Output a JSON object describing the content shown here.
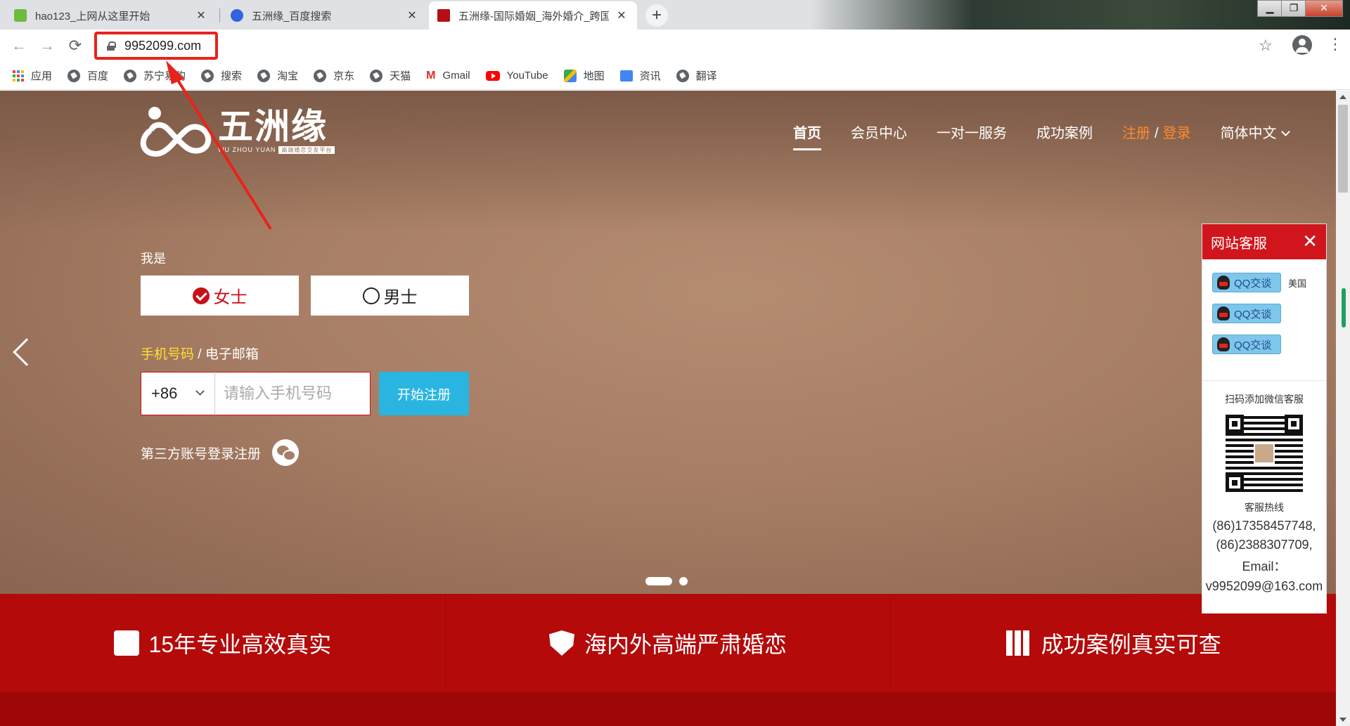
{
  "browser": {
    "tabs": [
      {
        "title": "hao123_上网从这里开始",
        "close": "✕",
        "fav_color": "#6dbb3a"
      },
      {
        "title": "五洲缘_百度搜索",
        "close": "✕",
        "fav_color": "#3165de"
      },
      {
        "title": "五洲缘-国际婚姻_海外婚介_跨国",
        "close": "✕",
        "fav_color": "#b50f14"
      }
    ],
    "new_tab": "+",
    "window_controls": [
      "▁",
      "❐",
      "✕"
    ],
    "url": "9952099.com",
    "bookmarks": [
      {
        "label": "应用",
        "icon": "apps-icon"
      },
      {
        "label": "百度",
        "icon": "globe-icon"
      },
      {
        "label": "苏宁易购",
        "icon": "globe-icon"
      },
      {
        "label": "搜索",
        "icon": "globe-icon"
      },
      {
        "label": "淘宝",
        "icon": "globe-icon"
      },
      {
        "label": "京东",
        "icon": "globe-icon"
      },
      {
        "label": "天猫",
        "icon": "globe-icon"
      },
      {
        "label": "Gmail",
        "icon": "gmail-icon"
      },
      {
        "label": "YouTube",
        "icon": "youtube-icon"
      },
      {
        "label": "地图",
        "icon": "maps-icon"
      },
      {
        "label": "资讯",
        "icon": "news-icon"
      },
      {
        "label": "翻译",
        "icon": "globe-icon"
      }
    ]
  },
  "site": {
    "logo_cn": "五洲缘",
    "logo_en": "WU ZHOU YUAN",
    "logo_tag": "高端婚恋交友平台",
    "nav": {
      "home": "首页",
      "member": "会员中心",
      "service": "一对一服务",
      "cases": "成功案例",
      "register": "注册",
      "slash": "/",
      "login": "登录",
      "language": "简体中文"
    },
    "form": {
      "iam": "我是",
      "female": "女士",
      "male": "男士",
      "phone_label": "手机号码",
      "separator": " / ",
      "email_label": "电子邮箱",
      "country_code": "+86",
      "phone_placeholder": "请输入手机号码",
      "start_button": "开始注册",
      "third_party": "第三方账号登录注册"
    },
    "features": [
      {
        "text": "15年专业高效真实",
        "icon": "calendar-icon"
      },
      {
        "text": "海内外高端严肃婚恋",
        "icon": "shield-icon"
      },
      {
        "text": "成功案例真实可查",
        "icon": "books-icon"
      }
    ],
    "carousel": {
      "slides": 2,
      "active": 1
    }
  },
  "cs_panel": {
    "title": "网站客服",
    "close": "✕",
    "qq_buttons": [
      {
        "label": "QQ交谈",
        "note": "美国"
      },
      {
        "label": "QQ交谈",
        "note": ""
      },
      {
        "label": "QQ交谈",
        "note": ""
      }
    ],
    "wechat_label": "扫码添加微信客服",
    "hotline_label": "客服热线",
    "phone1": "(86)17358457748,",
    "phone2": "(86)2388307709,",
    "email_label": "Email：",
    "email": "v9952099@163.com"
  },
  "colors": {
    "brand_red": "#b40a0a",
    "accent_blue": "#2ab5e0",
    "annotation_red": "#e8231b",
    "nav_orange": "#ff8a2a"
  }
}
